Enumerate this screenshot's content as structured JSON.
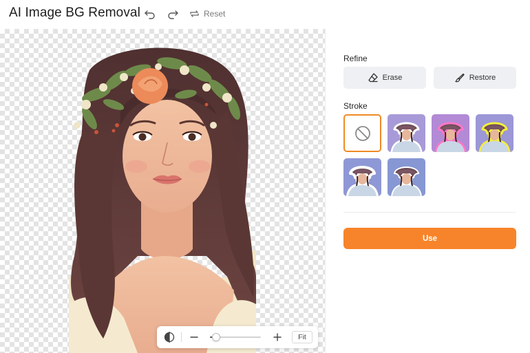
{
  "app": {
    "title": "AI Image BG Removal"
  },
  "toolbar": {
    "reset_label": "Reset"
  },
  "zoom": {
    "fit_label": "Fit",
    "level_fraction": 0.12
  },
  "panel": {
    "refine_label": "Refine",
    "erase_label": "Erase",
    "restore_label": "Restore",
    "stroke_label": "Stroke",
    "use_label": "Use",
    "stroke_options": [
      {
        "name": "none",
        "selected": true
      },
      {
        "name": "white",
        "color": "#ffffff",
        "bg": "#a89ad8"
      },
      {
        "name": "pink",
        "color": "#ff77c8",
        "bg": "#b28ad6"
      },
      {
        "name": "yellow",
        "color": "#f4ef3c",
        "bg": "#9c97d6"
      },
      {
        "name": "white-thick",
        "color": "#ffffff",
        "bg": "#8f98d6"
      },
      {
        "name": "white-thin",
        "color": "#ffffff",
        "bg": "#8797d4"
      }
    ]
  },
  "colors": {
    "accent": "#f7842a",
    "selected_border": "#f08a24",
    "button_bg": "#eef0f3"
  }
}
